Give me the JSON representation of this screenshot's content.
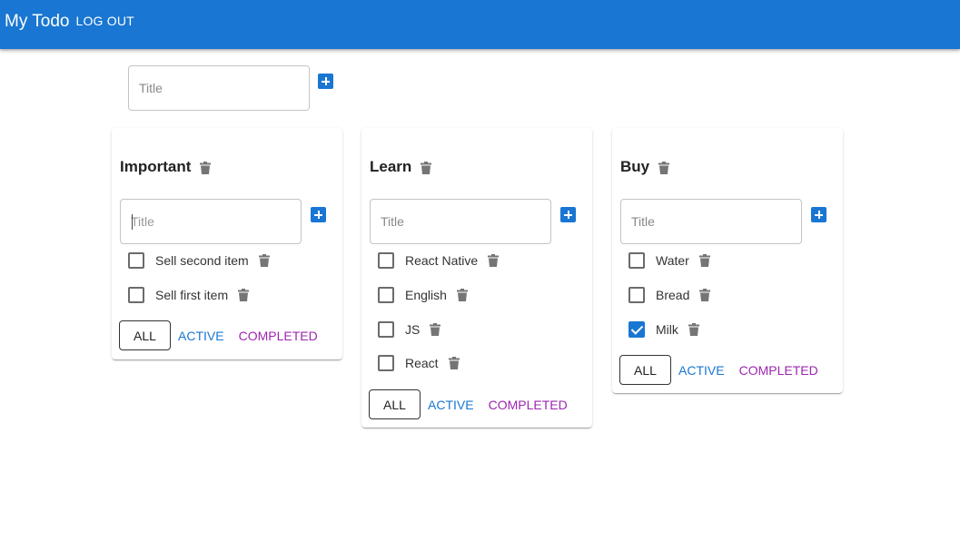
{
  "header": {
    "title": "My Todo",
    "logout_label": "LOG OUT",
    "color": "#1976d2"
  },
  "new_list": {
    "placeholder": "Title",
    "add_icon": "add-box-icon"
  },
  "lists": [
    {
      "title": "Important",
      "input_placeholder": "Title",
      "items": [
        {
          "label": "Sell second item",
          "checked": false
        },
        {
          "label": "Sell first item",
          "checked": false
        }
      ],
      "filters": {
        "all": "ALL",
        "active": "ACTIVE",
        "completed": "COMPLETED"
      }
    },
    {
      "title": "Learn",
      "input_placeholder": "Title",
      "items": [
        {
          "label": "React Native",
          "checked": false
        },
        {
          "label": "English",
          "checked": false
        },
        {
          "label": "JS",
          "checked": false
        },
        {
          "label": "React",
          "checked": false
        }
      ],
      "filters": {
        "all": "ALL",
        "active": "ACTIVE",
        "completed": "COMPLETED"
      }
    },
    {
      "title": "Buy",
      "input_placeholder": "Title",
      "items": [
        {
          "label": "Water",
          "checked": false
        },
        {
          "label": "Bread",
          "checked": false
        },
        {
          "label": "Milk",
          "checked": true
        }
      ],
      "filters": {
        "all": "ALL",
        "active": "ACTIVE",
        "completed": "COMPLETED"
      }
    }
  ],
  "colors": {
    "primary": "#1976d2",
    "secondary": "#9c27b0",
    "icon_gray": "#757575"
  }
}
